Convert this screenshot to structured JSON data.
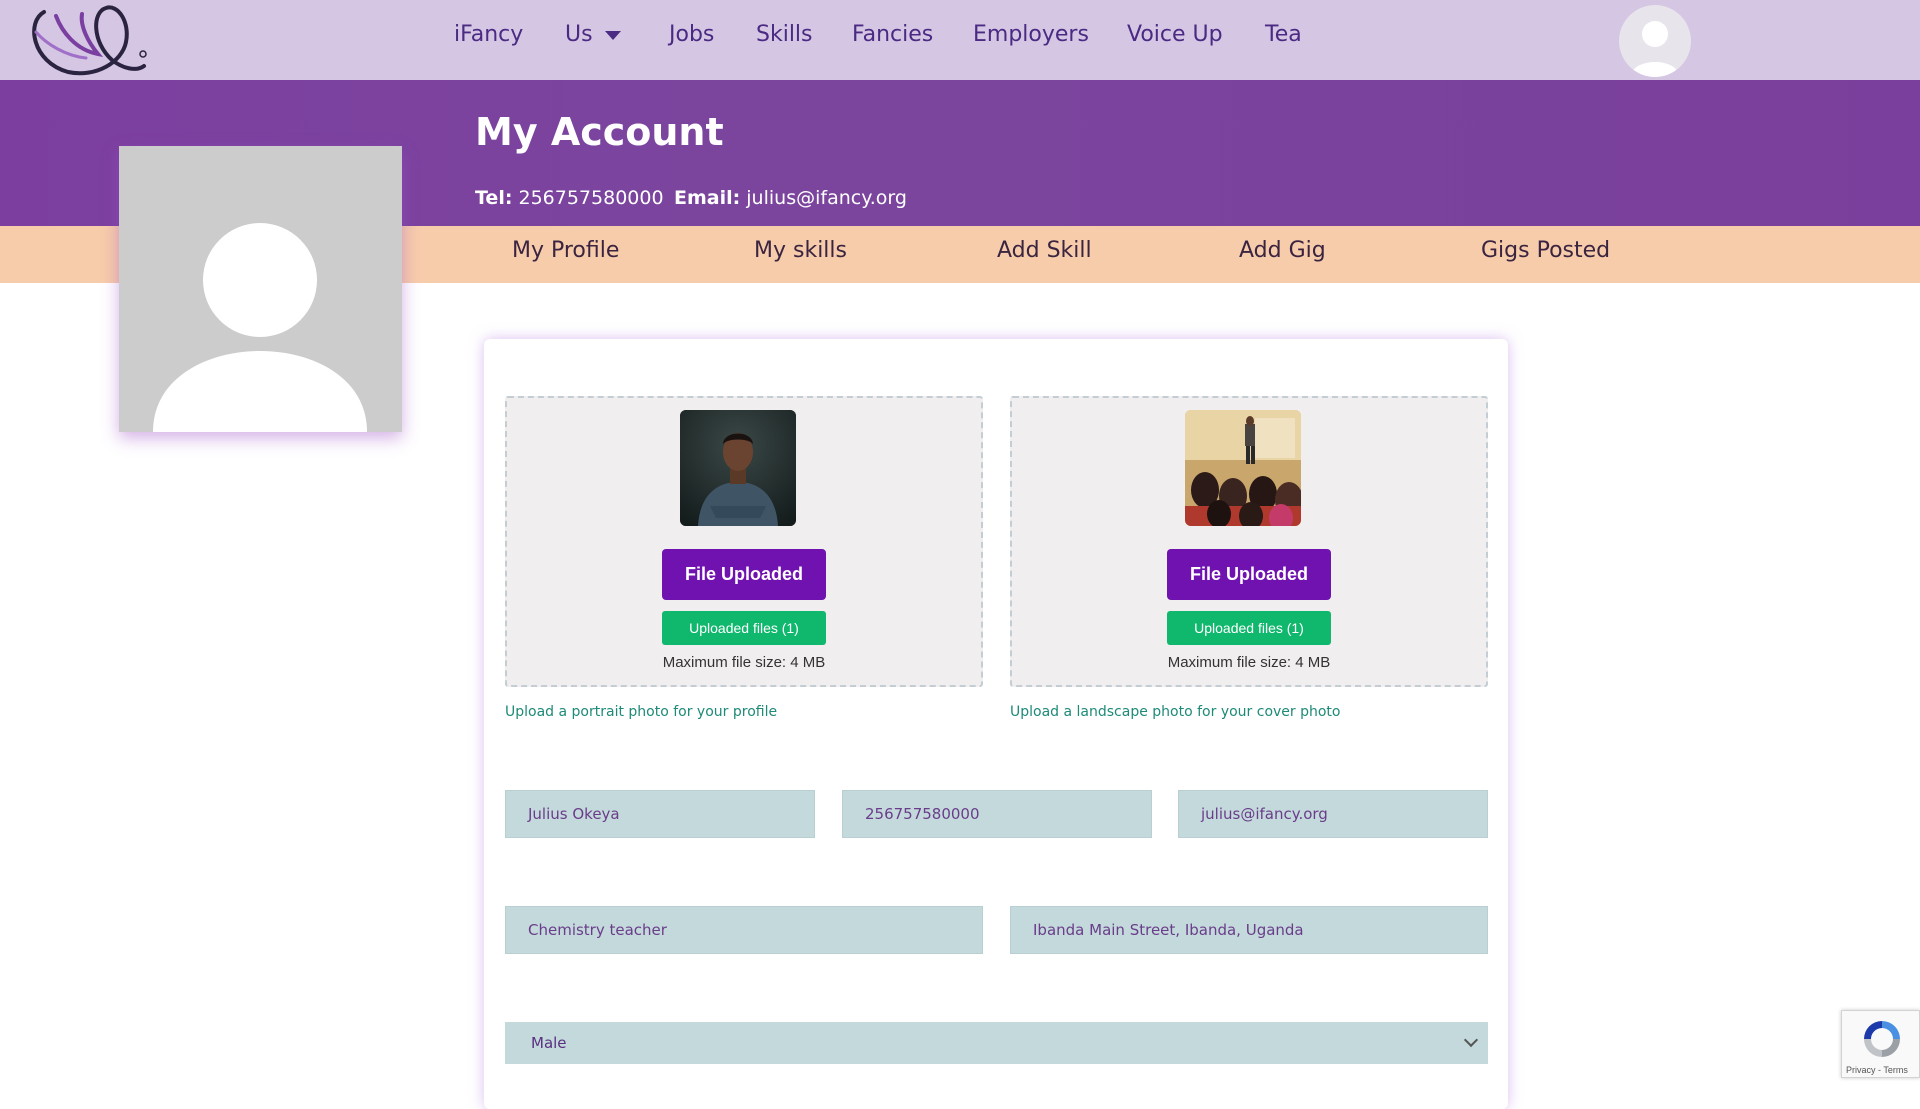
{
  "nav": {
    "items": [
      "iFancy",
      "Us",
      "Jobs",
      "Skills",
      "Fancies",
      "Employers",
      "Voice Up",
      "Tea"
    ]
  },
  "header": {
    "title": "My Account",
    "tel_label": "Tel:",
    "tel_value": "256757580000",
    "email_label": "Email:",
    "email_value": "julius@ifancy.org"
  },
  "tabs": [
    "My Profile",
    "My skills",
    "Add Skill",
    "Add Gig",
    "Gigs Posted"
  ],
  "uploads": {
    "portrait": {
      "button": "File Uploaded",
      "files": "Uploaded files (1)",
      "max": "Maximum file size: 4 MB",
      "hint": "Upload a portrait photo for your profile"
    },
    "cover": {
      "button": "File Uploaded",
      "files": "Uploaded files (1)",
      "max": "Maximum file size: 4 MB",
      "hint": "Upload a landscape photo for your cover photo"
    }
  },
  "form": {
    "name": "Julius Okeya",
    "phone": "256757580000",
    "email": "julius@ifancy.org",
    "occupation": "Chemistry teacher",
    "address": "Ibanda Main Street, Ibanda, Uganda",
    "gender": "Male"
  },
  "recaptcha": {
    "privacy": "Privacy",
    "terms": "Terms"
  },
  "colors": {
    "nav_bg": "#d5c6e4",
    "banner": "#7b429e",
    "tabbar": "#f7ccaa",
    "primary_button": "#7012b0",
    "success_button": "#10b86e",
    "field_bg": "#c3d9db"
  }
}
